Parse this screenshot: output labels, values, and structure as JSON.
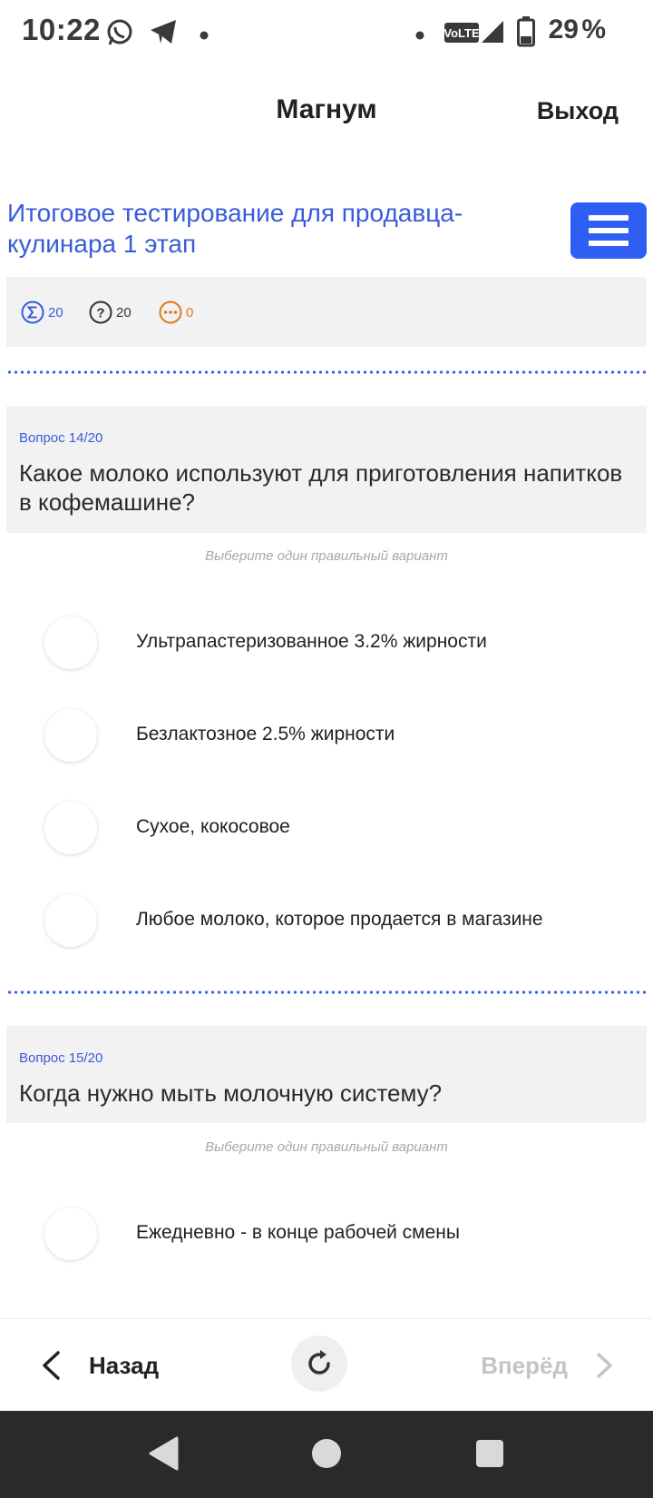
{
  "status_bar": {
    "time": "10:22",
    "network": "VoLTE",
    "battery": "29",
    "battery_unit": "%",
    "icons": [
      "whatsapp-icon",
      "telegram-icon",
      "dot-icon",
      "dot-icon",
      "volte-icon",
      "signal-icon",
      "battery-icon"
    ]
  },
  "header": {
    "title": "Магнум",
    "logout_label": "Выход"
  },
  "test": {
    "title": "Итоговое тестирование для продавца-кулинара 1 этап"
  },
  "stats": {
    "total": "20",
    "questions": "20",
    "pending": "0",
    "colors": {
      "total": "#3a5bd9",
      "questions": "#333333",
      "pending": "#e07a1f"
    }
  },
  "questions": [
    {
      "number": "Вопрос 14/20",
      "text": "Какое молоко используют для приготовления напитков в кофемашине?",
      "hint": "Выберите один правильный вариант",
      "options": [
        "Ультрапастеризованное 3.2% жирности",
        "Безлактозное 2.5% жирности",
        "Сухое, кокосовое",
        "Любое молоко, которое продается в магазине"
      ]
    },
    {
      "number": "Вопрос 15/20",
      "text": "Когда нужно мыть молочную систему?",
      "hint": "Выберите один правильный вариант",
      "options": [
        "Ежедневно - в конце рабочей смены"
      ]
    }
  ],
  "footer": {
    "back_label": "Назад",
    "forward_label": "Вперёд"
  },
  "colors": {
    "accent": "#2e5ff2",
    "link": "#3a5bd9",
    "panel_bg": "#f2f2f2",
    "disabled": "#c4c4c4",
    "system_nav_bg": "#2a2a2a"
  }
}
